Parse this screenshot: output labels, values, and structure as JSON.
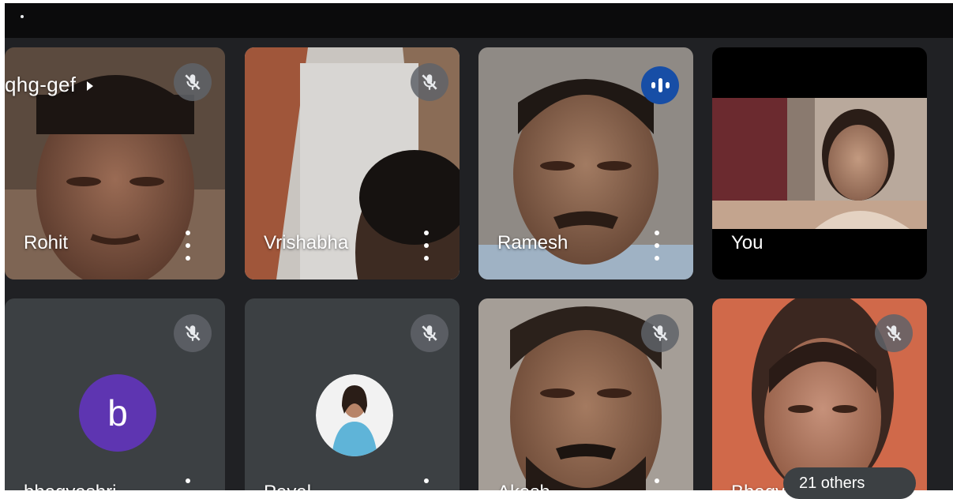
{
  "meeting": {
    "code": "qhg-gef"
  },
  "participants": [
    {
      "name": "Rohit",
      "mic": "muted-icon"
    },
    {
      "name": "Vrishabha",
      "mic": "muted-icon"
    },
    {
      "name": "Ramesh",
      "mic": "speaking-indicator-icon"
    },
    {
      "name": "You",
      "mic": "none"
    },
    {
      "name": "bhagyashri",
      "mic": "muted-icon",
      "avatar_letter": "b"
    },
    {
      "name": "Payal",
      "mic": "muted-icon"
    },
    {
      "name": "Akash",
      "mic": "muted-icon"
    },
    {
      "name": "Bhagy",
      "mic": "muted-icon"
    }
  ],
  "others_label": "21 others",
  "colors": {
    "background": "#202124",
    "tile": "#3c4043",
    "avatar_purple": "#5e35b1",
    "speaking_blue": "#174ea6"
  }
}
